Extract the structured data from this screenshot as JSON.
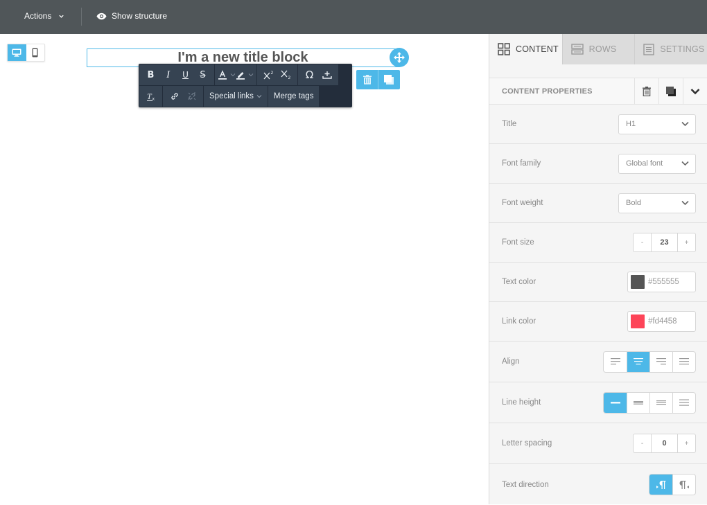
{
  "topbar": {
    "actions_label": "Actions",
    "show_structure_label": "Show structure"
  },
  "canvas": {
    "device_toggle": {
      "options": [
        "desktop",
        "mobile"
      ],
      "active": "desktop"
    },
    "title_block": {
      "text": "I'm a new title block"
    },
    "rich_text_toolbar": {
      "row1": [
        "bold",
        "italic",
        "underline",
        "strikethrough",
        "text-color",
        "highlight-color",
        "superscript",
        "subscript",
        "special-character",
        "insert"
      ],
      "row2": [
        "clear-formatting",
        "link",
        "unlink"
      ],
      "special_links_label": "Special links",
      "merge_tags_label": "Merge tags",
      "glyphs": {
        "bold": "B",
        "italic": "I",
        "underline": "U",
        "strike": "S",
        "special_char": "Ω"
      }
    }
  },
  "panel": {
    "tabs": [
      {
        "label": "CONTENT",
        "icon": "grid-icon",
        "active": true
      },
      {
        "label": "ROWS",
        "icon": "rows-icon",
        "active": false
      },
      {
        "label": "SETTINGS",
        "icon": "settings-doc-icon",
        "active": false
      }
    ],
    "properties_title": "CONTENT PROPERTIES",
    "props": {
      "title": {
        "label": "Title",
        "value": "H1"
      },
      "font_family": {
        "label": "Font family",
        "value": "Global font"
      },
      "font_weight": {
        "label": "Font weight",
        "value": "Bold"
      },
      "font_size": {
        "label": "Font size",
        "value": "23",
        "minus": "-",
        "plus": "+"
      },
      "text_color": {
        "label": "Text color",
        "value": "#555555"
      },
      "link_color": {
        "label": "Link color",
        "value": "#fd4458"
      },
      "align": {
        "label": "Align",
        "options": [
          "left",
          "center",
          "right",
          "justify"
        ],
        "active": "center"
      },
      "line_height": {
        "label": "Line height",
        "options": [
          "1",
          "1.2",
          "1.5",
          "2"
        ],
        "active_index": 0
      },
      "letter_spacing": {
        "label": "Letter spacing",
        "value": "0",
        "minus": "-",
        "plus": "+"
      },
      "text_direction": {
        "label": "Text direction",
        "options": [
          "ltr",
          "rtl"
        ],
        "active": "ltr"
      }
    }
  },
  "colors": {
    "accent": "#4db8e8",
    "topbar": "#505659",
    "toolbar": "#232d3b",
    "text_color": "#555555",
    "link_color": "#fd4458"
  }
}
